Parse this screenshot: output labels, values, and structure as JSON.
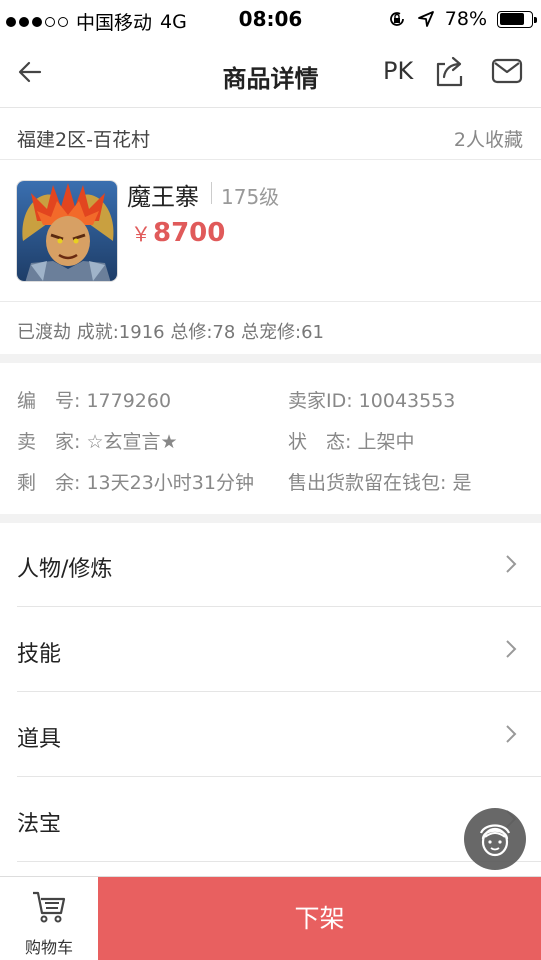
{
  "status_bar": {
    "carrier": "中国移动",
    "network": "4G",
    "time": "08:06",
    "battery": "78%",
    "battery_level": 0.78
  },
  "nav": {
    "title": "商品详情",
    "pk": "PK"
  },
  "server": {
    "name": "福建2区-百花村",
    "favorites": "2人收藏"
  },
  "product": {
    "name": "魔王寨",
    "level": "175级",
    "currency": "￥",
    "price": "8700",
    "stats": "已渡劫 成就:1916 总修:78 总宠修:61"
  },
  "info": {
    "number": "编　号: 1779260",
    "seller_id": "卖家ID: 10043553",
    "seller": "卖　家: ☆玄宣言★",
    "state": "状　态: 上架中",
    "remaining": "剩　余: 13天23小时31分钟",
    "wallet": "售出货款留在钱包: 是"
  },
  "menu": [
    {
      "label": "人物/修炼"
    },
    {
      "label": "技能"
    },
    {
      "label": "道具"
    },
    {
      "label": "法宝"
    }
  ],
  "bottom": {
    "cart_label": "购物车",
    "action_label": "下架"
  },
  "colors": {
    "accent": "#e86060",
    "price": "#e05a5a"
  }
}
